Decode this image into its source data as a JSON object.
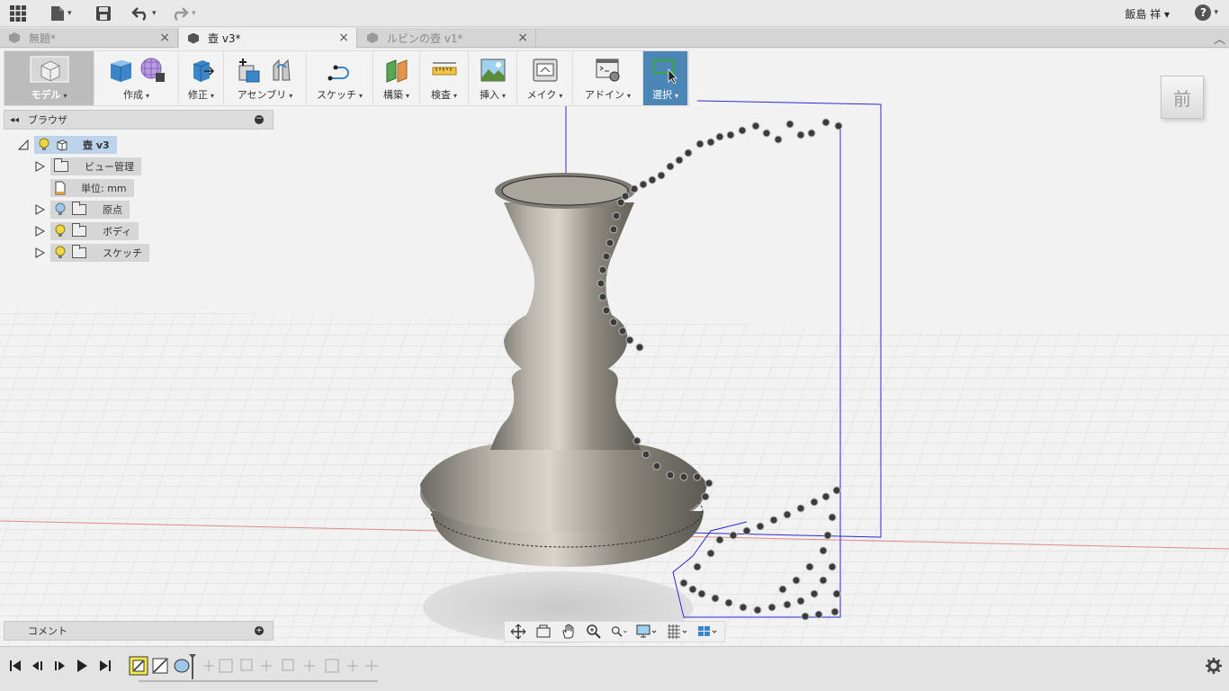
{
  "app": {
    "user_name": "飯島 祥 ▾",
    "help_label": "?"
  },
  "tabs": [
    {
      "label": "無題*",
      "active": false
    },
    {
      "label": "壺 v3*",
      "active": true
    },
    {
      "label": "ルビンの壺 v1*",
      "active": false
    }
  ],
  "toolbar": {
    "model": "モデル",
    "create": "作成",
    "modify": "修正",
    "assemble": "アセンブリ",
    "sketch": "スケッチ",
    "construct": "構築",
    "inspect": "検査",
    "insert": "挿入",
    "make": "メイク",
    "addins": "アドイン",
    "select": "選択"
  },
  "browser": {
    "title": "ブラウザ",
    "root": "壺 v3",
    "items": [
      {
        "label": "ビュー管理",
        "bulb": false,
        "bulb_color": ""
      },
      {
        "label": "単位: mm",
        "bulb": false,
        "bulb_color": ""
      },
      {
        "label": "原点",
        "bulb": true,
        "bulb_color": "#9fc6e8"
      },
      {
        "label": "ボディ",
        "bulb": true,
        "bulb_color": "#f2d542"
      },
      {
        "label": "スケッチ",
        "bulb": true,
        "bulb_color": "#f2d542"
      }
    ]
  },
  "comment": {
    "label": "コメント"
  },
  "viewcube": {
    "face_label": "前"
  },
  "colors": {
    "accent": "#4b86b6",
    "bulb_on": "#f2d542",
    "bulb_origin": "#9fc6e8",
    "sketch_line": "#2a2ad8",
    "axis_x": "#e08080"
  }
}
